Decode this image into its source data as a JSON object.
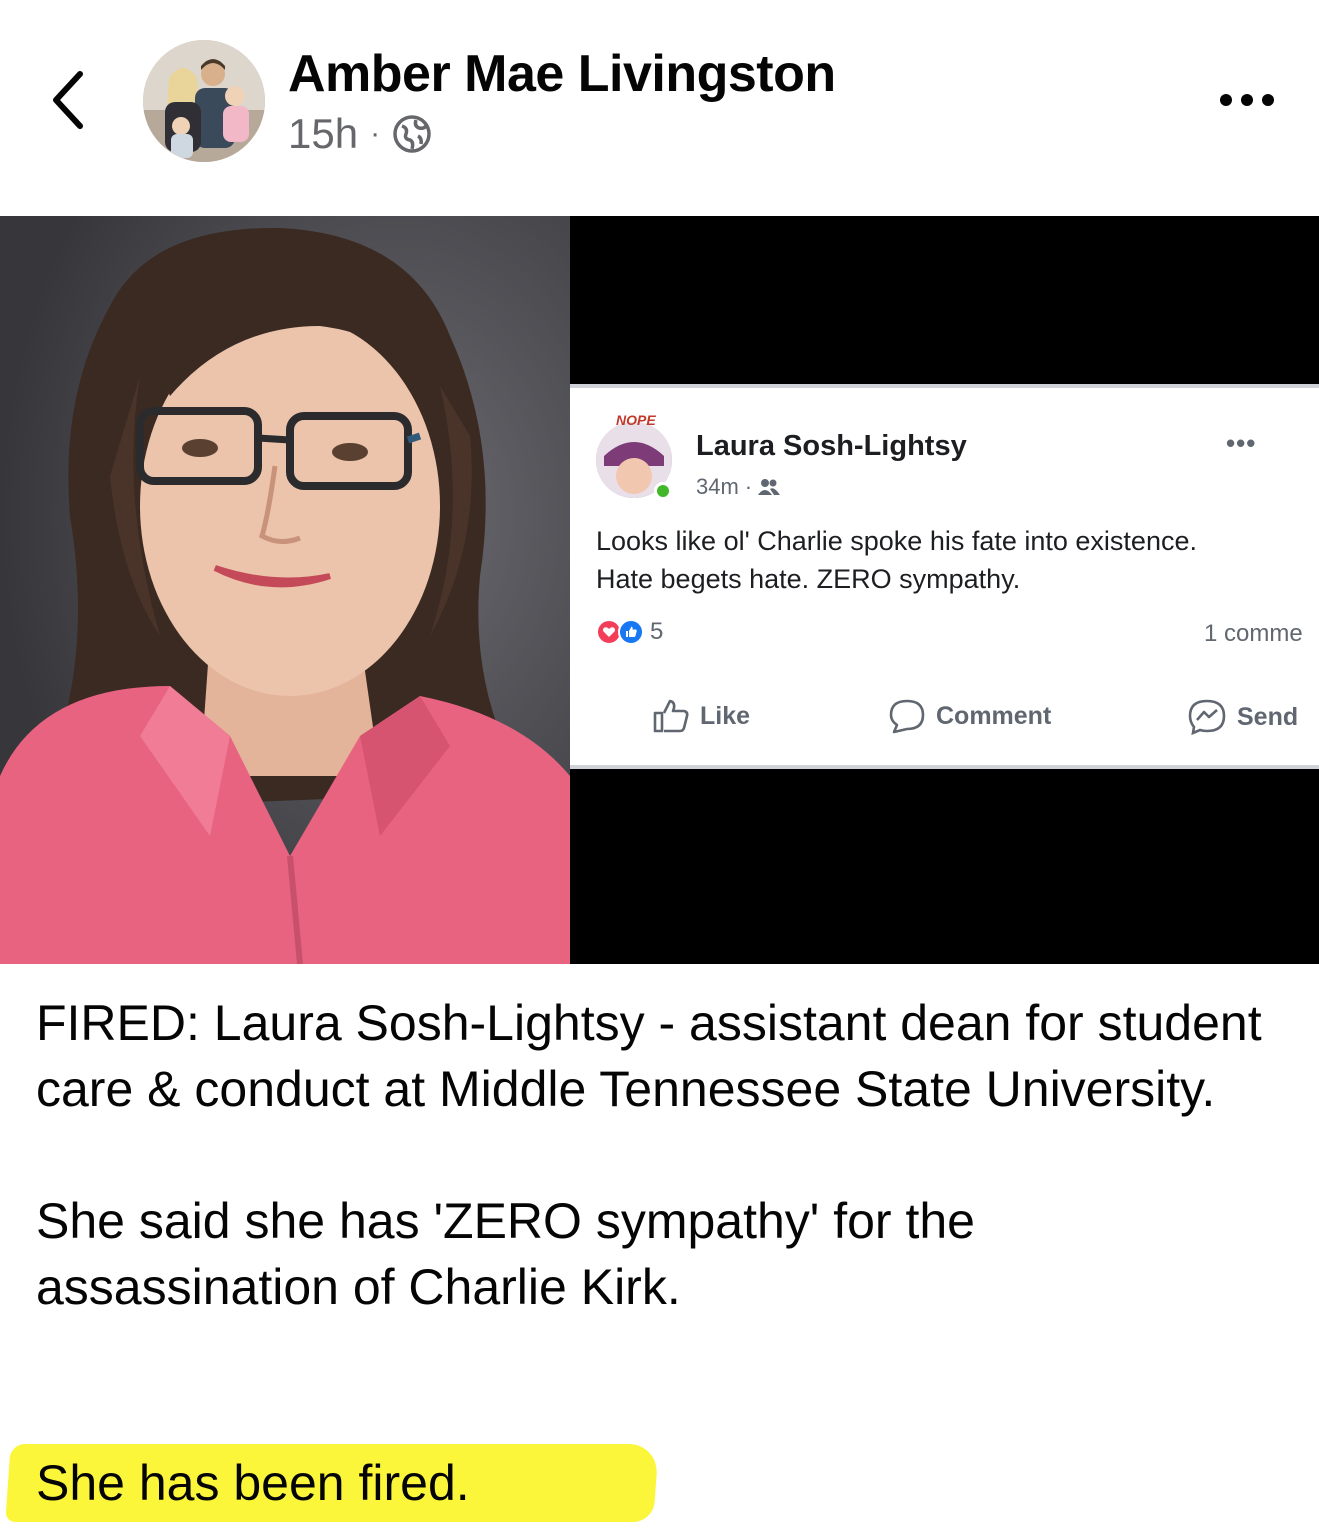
{
  "header": {
    "author_name": "Amber Mae Livingston",
    "time": "15h",
    "separator": "·",
    "audience_icon": "globe-icon",
    "back_icon": "chevron-left-icon",
    "more_icon": "more-horizontal-icon"
  },
  "embedded_post": {
    "badge": "NOPE",
    "author_name": "Laura Sosh-Lightsy",
    "time": "34m",
    "separator": "·",
    "audience_icon": "friends-icon",
    "text_line1": "Looks like ol' Charlie spoke his fate into existence.",
    "text_line2": "Hate begets hate. ZERO sympathy.",
    "reaction_count": "5",
    "comments_label": "1 comme",
    "actions": {
      "like": "Like",
      "comment": "Comment",
      "send": "Send"
    }
  },
  "post": {
    "paragraph1": "FIRED: Laura Sosh-Lightsy - assistant dean for student care & conduct at Middle Tennessee State University.",
    "paragraph2": "She said she has 'ZERO sympathy' for the assassination of Charlie Kirk.",
    "paragraph3": "She has been fired."
  },
  "colors": {
    "highlight": "#fbf63a",
    "secondary_text": "#65676b",
    "blouse": "#e8637f"
  }
}
